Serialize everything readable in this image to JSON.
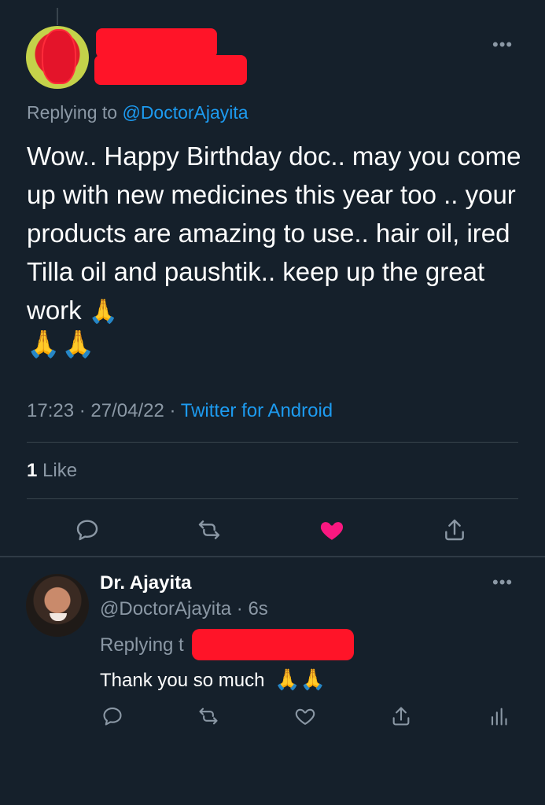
{
  "main_tweet": {
    "replying_prefix": "Replying to",
    "replying_handle": "@DoctorAjayita",
    "text": "Wow.. Happy Birthday doc.. may you come up with new medicines this year too .. your products are amazing to use.. hair oil, ired Tilla oil and paushtik.. keep up the great work",
    "emoji_inline": "🙏",
    "emoji_row": "🙏🙏",
    "time": "17:23",
    "date": "27/04/22",
    "separator": "·",
    "source": "Twitter for Android",
    "like_count": "1",
    "like_label": "Like",
    "liked": true,
    "actions": [
      "reply-icon",
      "retweet-icon",
      "like-icon",
      "share-icon"
    ]
  },
  "reply_tweet": {
    "name": "Dr. Ajayita",
    "handle": "@DoctorAjayita",
    "time": "6s",
    "separator": "·",
    "replying_prefix": "Replying t",
    "text": "Thank you so much",
    "emoji": "🙏🙏",
    "actions": [
      "reply-icon",
      "retweet-icon",
      "like-icon",
      "share-icon",
      "analytics-icon"
    ]
  },
  "colors": {
    "background": "#15202b",
    "text": "#ffffff",
    "secondary": "#8b98a5",
    "accent": "#1d9bf0",
    "like": "#f91880",
    "redaction": "#ff1428"
  }
}
